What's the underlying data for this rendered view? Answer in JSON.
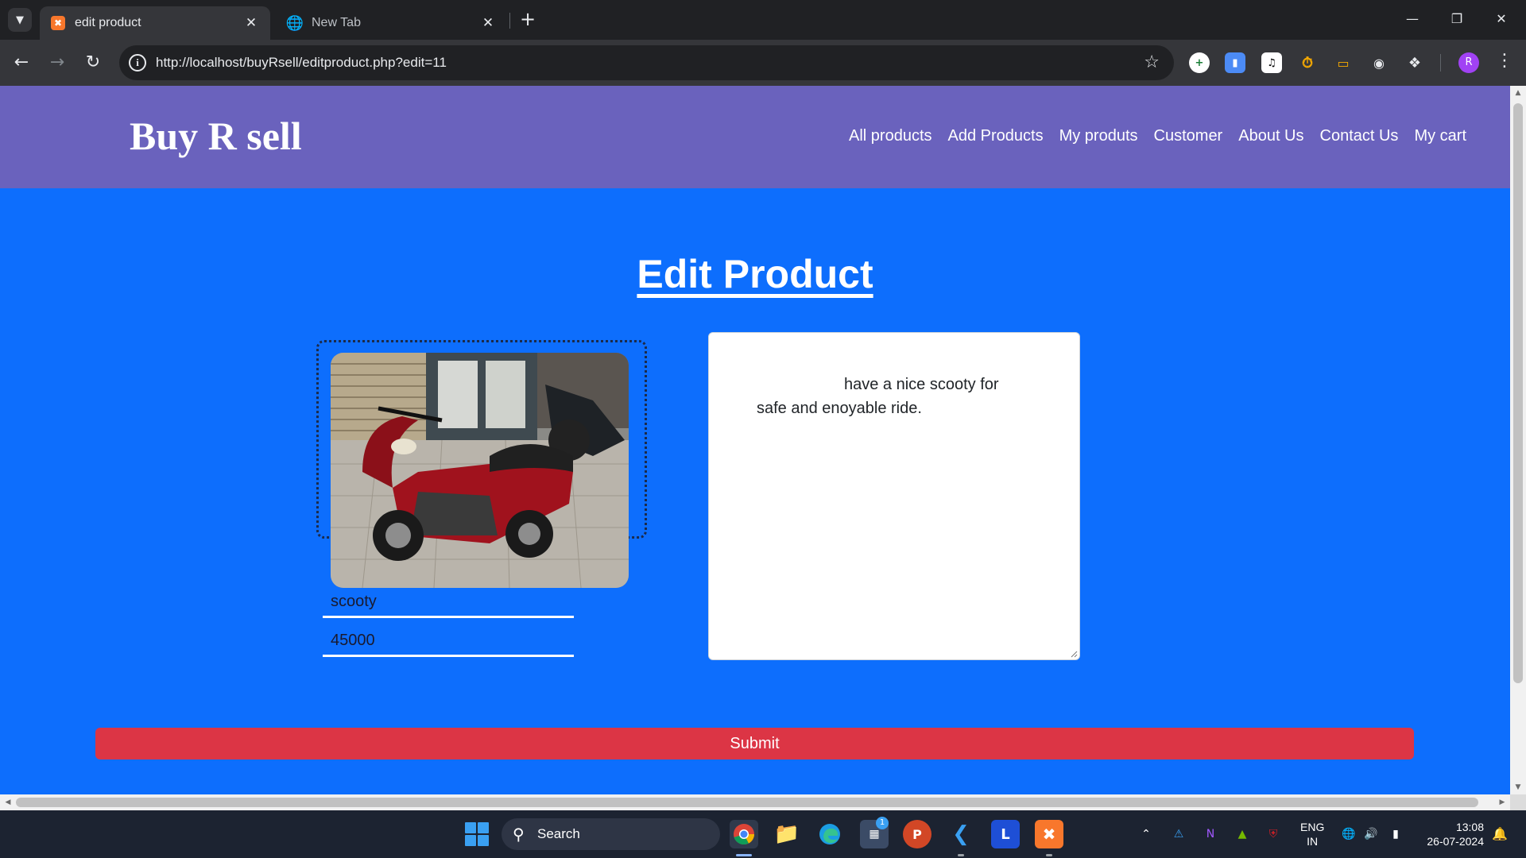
{
  "browser": {
    "tabs": [
      {
        "title": "edit product",
        "active": true
      },
      {
        "title": "New Tab",
        "active": false
      }
    ],
    "url": "http://localhost/buyRsell/editproduct.php?edit=11",
    "profile_initial": "R",
    "extension_count": 6
  },
  "site": {
    "brand": "Buy R sell",
    "nav": [
      "All products",
      "Add Products",
      "My produts",
      "Customer",
      "About Us",
      "Contact Us",
      "My cart"
    ]
  },
  "page": {
    "title": "Edit Product",
    "product_name": "scooty",
    "product_price": "45000",
    "description": "have a nice scooty for safe and enoyable ride.",
    "submit_label": "Submit"
  },
  "taskbar": {
    "search_label": "Search",
    "store_badge": "1",
    "lang_line1": "ENG",
    "lang_line2": "IN",
    "time": "13:08",
    "date": "26-07-2024"
  },
  "colors": {
    "page_bg": "#0d6efd",
    "header_bg": "#6a62bd",
    "submit_bg": "#dc3545"
  }
}
